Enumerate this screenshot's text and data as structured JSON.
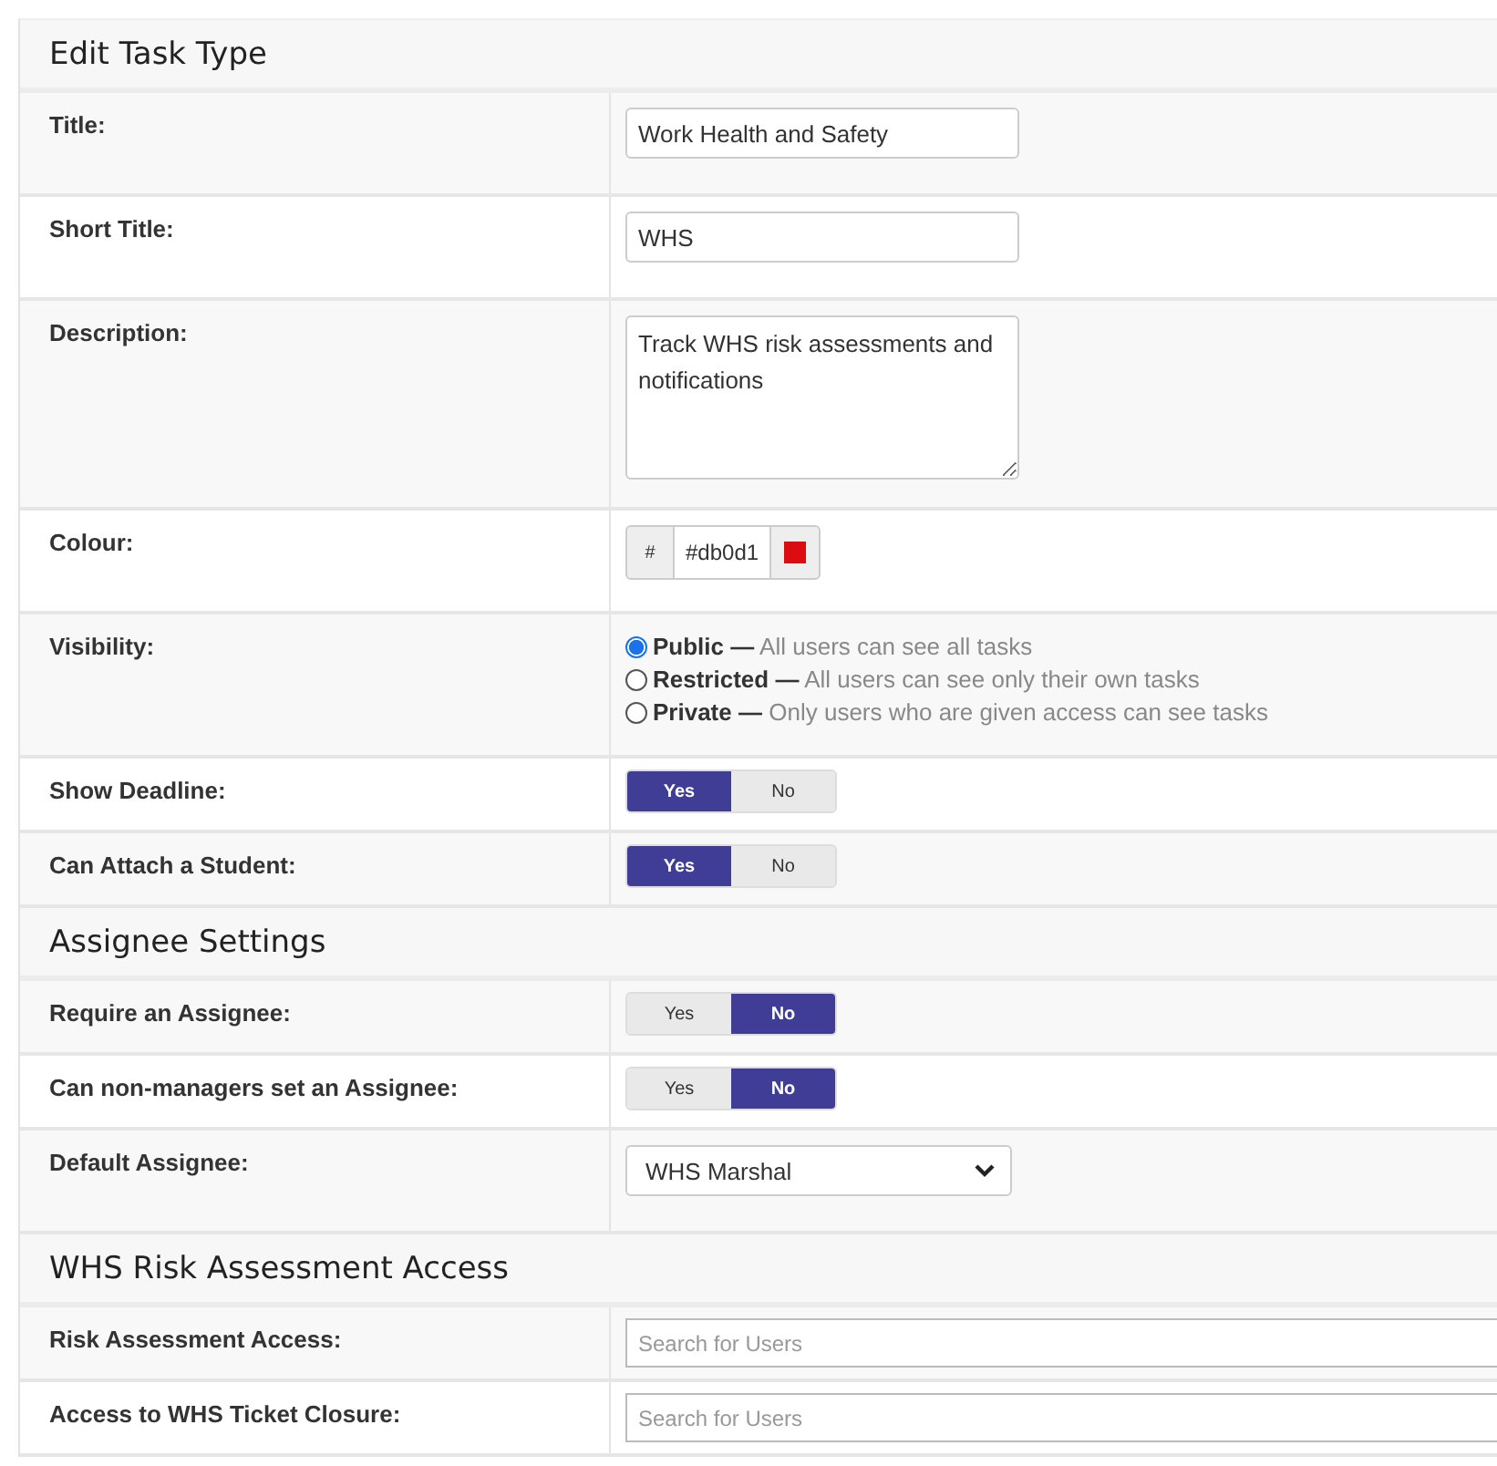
{
  "sections": [
    {
      "title": "Edit Task Type",
      "rows": [
        {
          "kind": "text",
          "label": "Title:",
          "value": "Work Health and Safety"
        },
        {
          "kind": "text",
          "label": "Short Title:",
          "value": "WHS"
        },
        {
          "kind": "textarea",
          "label": "Description:",
          "value": "Track WHS risk assessments and notifications"
        },
        {
          "kind": "colour",
          "label": "Colour:",
          "prefix": "#",
          "value": "#db0d1",
          "color": "#db0d10"
        },
        {
          "kind": "radio",
          "label": "Visibility:",
          "options": [
            {
              "name": "Public",
              "separator": "—",
              "description": "All users can see all tasks",
              "selected": true
            },
            {
              "name": "Restricted",
              "separator": "—",
              "description": "All users can see only their own tasks",
              "selected": false
            },
            {
              "name": "Private",
              "separator": "—",
              "description": "Only users who are given access can see tasks",
              "selected": false
            }
          ]
        },
        {
          "kind": "toggle",
          "label": "Show Deadline:",
          "options": [
            {
              "label": "Yes",
              "selected": true
            },
            {
              "label": "No",
              "selected": false
            }
          ]
        },
        {
          "kind": "toggle",
          "label": "Can Attach a Student:",
          "options": [
            {
              "label": "Yes",
              "selected": true
            },
            {
              "label": "No",
              "selected": false
            }
          ]
        }
      ]
    },
    {
      "title": "Assignee Settings",
      "rows": [
        {
          "kind": "toggle",
          "label": "Require an Assignee:",
          "options": [
            {
              "label": "Yes",
              "selected": false
            },
            {
              "label": "No",
              "selected": true
            }
          ]
        },
        {
          "kind": "toggle",
          "label": "Can non-managers set an Assignee:",
          "options": [
            {
              "label": "Yes",
              "selected": false
            },
            {
              "label": "No",
              "selected": true
            }
          ]
        },
        {
          "kind": "select",
          "label": "Default Assignee:",
          "value": "WHS Marshal"
        }
      ]
    },
    {
      "title": "WHS Risk Assessment Access",
      "rows": [
        {
          "kind": "search",
          "label": "Risk Assessment Access:",
          "placeholder": "Search for Users"
        },
        {
          "kind": "search",
          "label": "Access to WHS Ticket Closure:",
          "placeholder": "Search for Users"
        }
      ]
    }
  ]
}
